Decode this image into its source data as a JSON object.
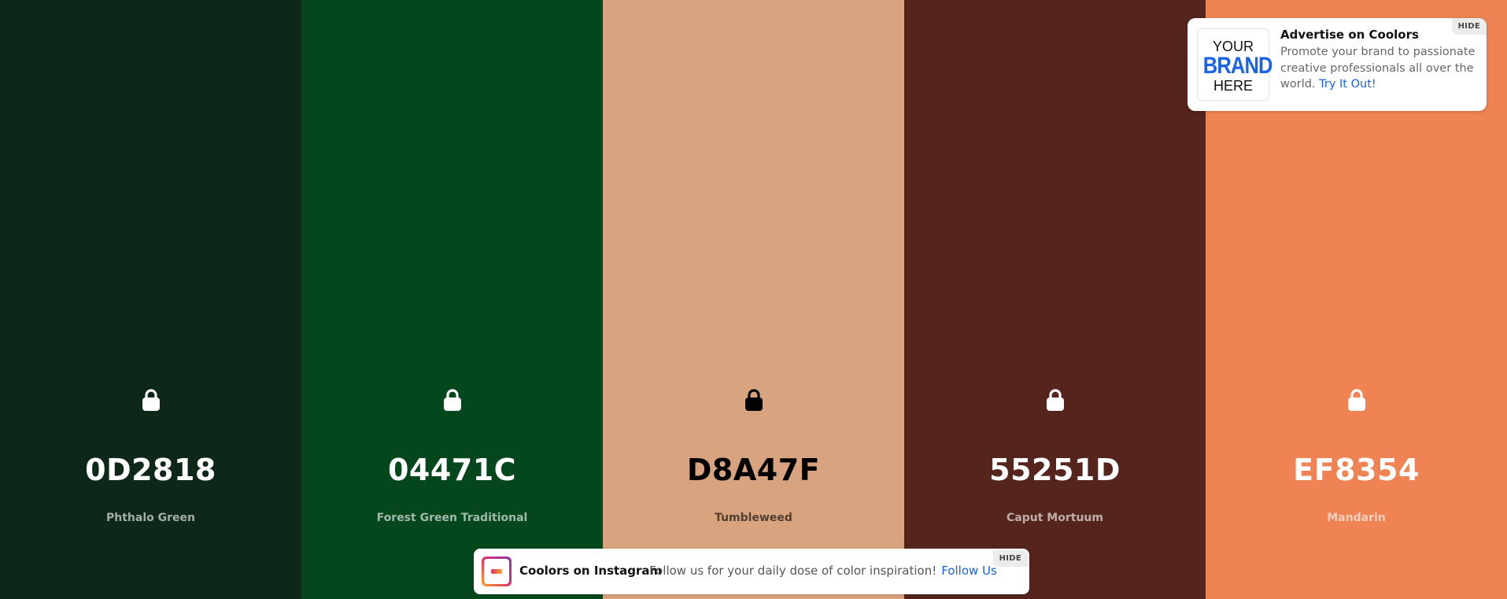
{
  "palette": [
    {
      "hex": "0D2818",
      "name": "Phthalo Green",
      "bg": "#0D2818",
      "fg": "#ffffff",
      "lock_color": "#ffffff",
      "lock_icon": "lock-icon"
    },
    {
      "hex": "04471C",
      "name": "Forest Green Traditional",
      "bg": "#04471C",
      "fg": "#ffffff",
      "lock_color": "#ffffff",
      "lock_icon": "lock-icon"
    },
    {
      "hex": "D8A47F",
      "name": "Tumbleweed",
      "bg": "#D8A47F",
      "fg": "#000000",
      "lock_color": "#000000",
      "lock_icon": "lock-icon"
    },
    {
      "hex": "55251D",
      "name": "Caput Mortuum",
      "bg": "#55251D",
      "fg": "#ffffff",
      "lock_color": "#ffffff",
      "lock_icon": "lock-icon"
    },
    {
      "hex": "EF8354",
      "name": "Mandarin",
      "bg": "#EF8354",
      "fg": "#ffffff",
      "lock_color": "#ffffff",
      "lock_icon": "lock-icon"
    }
  ],
  "ad": {
    "logo_line1": "YOUR",
    "logo_line2": "BRAND",
    "logo_line3": "HERE",
    "title": "Advertise on Coolors",
    "body": "Promote your brand to passionate creative professionals all over the world.",
    "cta": "Try It Out!",
    "hide_label": "HIDE",
    "accent": "#1a62e8"
  },
  "instagram": {
    "title": "Coolors on Instagram",
    "text": "Follow us for your daily dose of color inspiration!",
    "cta": "Follow Us",
    "hide_label": "HIDE",
    "logo_icon": "instagram-logo"
  }
}
